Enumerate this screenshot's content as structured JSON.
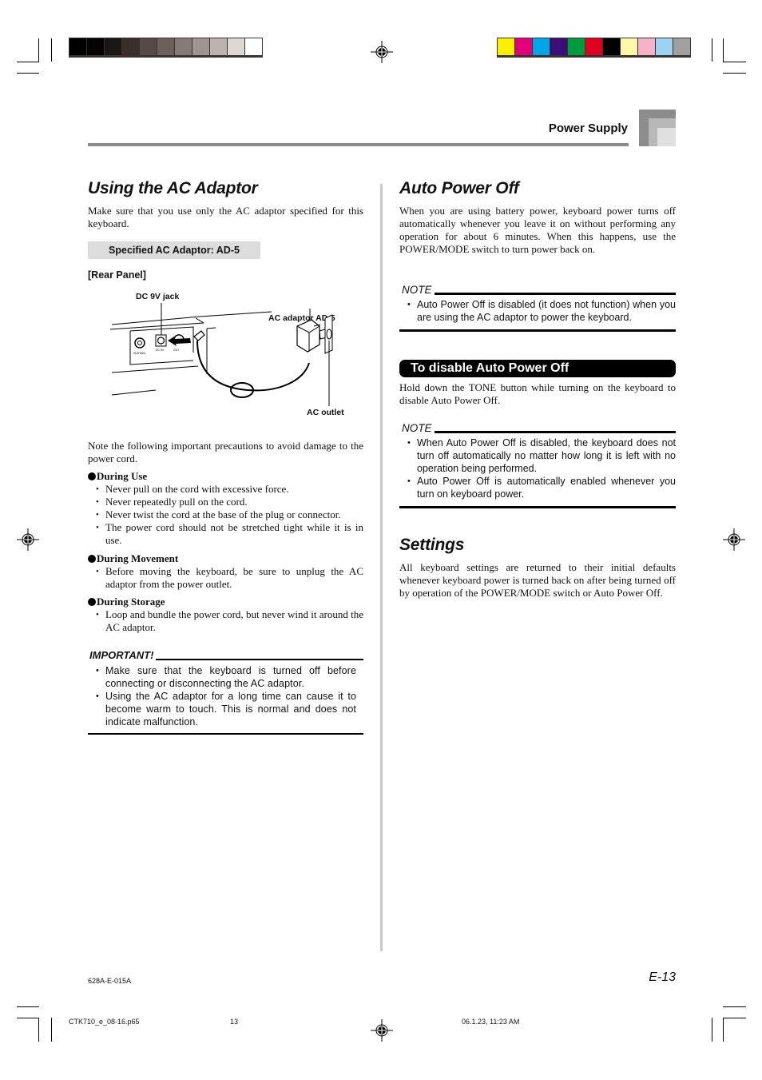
{
  "print_marks": {
    "gray_swatches": [
      "#000000",
      "#050303",
      "#1c1614",
      "#3a2e2a",
      "#554a46",
      "#6c605b",
      "#857a76",
      "#a09490",
      "#bdb3ae",
      "#ddd8d4",
      "#ffffff"
    ],
    "color_swatches": [
      "#f8f000",
      "#e2007a",
      "#00a6e8",
      "#3c0e7a",
      "#009b3e",
      "#e00020",
      "#000000",
      "#fff8a8",
      "#f6b0c8",
      "#9dd3f2",
      "#a0a0a0"
    ]
  },
  "header": {
    "section_title": "Power Supply"
  },
  "left": {
    "title": "Using the AC Adaptor",
    "intro": "Make sure that you use only the AC adaptor specified for this keyboard.",
    "spec_box": "Specified AC Adaptor: AD-5",
    "rear_panel_label": "[Rear Panel]",
    "diagram": {
      "dc_jack_label": "DC 9V jack",
      "adaptor_label": "AC adaptor AD-5",
      "outlet_label": "AC outlet",
      "panel_labels": [
        "SUSTAIN",
        "DC 9V",
        "OUT"
      ]
    },
    "precautions_intro": "Note the following important precautions to avoid damage to the power cord.",
    "groups": [
      {
        "heading": "During Use",
        "items": [
          "Never pull on the cord with excessive force.",
          "Never repeatedly pull on the cord.",
          "Never twist the cord at the base of the plug or connector.",
          "The power cord should not be stretched tight while it is in use."
        ]
      },
      {
        "heading": "During Movement",
        "items": [
          "Before moving the keyboard, be sure to unplug the AC adaptor from the power outlet."
        ]
      },
      {
        "heading": "During Storage",
        "items": [
          "Loop and bundle the power cord, but never wind it around the AC adaptor."
        ]
      }
    ],
    "important": {
      "label": "IMPORTANT!",
      "items": [
        "Make sure that the keyboard is turned off before connecting or disconnecting the AC adaptor.",
        "Using the AC adaptor for a long time can cause it to become warm to touch. This is normal and does not indicate malfunction."
      ]
    }
  },
  "right": {
    "title": "Auto Power Off",
    "intro": "When you are using battery power, keyboard power turns off automatically whenever you leave it on without performing any operation for about 6 minutes. When this happens, use the POWER/MODE switch to turn power back on.",
    "note1": {
      "label": "NOTE",
      "items": [
        "Auto Power Off is disabled (it does not function) when you are using the AC adaptor to power the keyboard."
      ]
    },
    "disable_heading": "To disable Auto Power Off",
    "disable_text": "Hold down the TONE button while turning on the keyboard to disable Auto Power Off.",
    "note2": {
      "label": "NOTE",
      "items": [
        "When Auto Power Off is disabled, the keyboard does not turn off automatically no matter how long it is left with no operation being performed.",
        "Auto Power Off is automatically enabled whenever you turn on keyboard power."
      ]
    },
    "settings_title": "Settings",
    "settings_text": "All keyboard settings are returned to their initial defaults whenever keyboard power is turned back on after being turned off by operation of the POWER/MODE switch or Auto Power Off."
  },
  "footer": {
    "doc_code": "628A-E-015A",
    "page_label": "E-13",
    "file_name": "CTK710_e_08-16.p65",
    "file_page": "13",
    "timestamp": "06.1.23, 11:23 AM"
  }
}
